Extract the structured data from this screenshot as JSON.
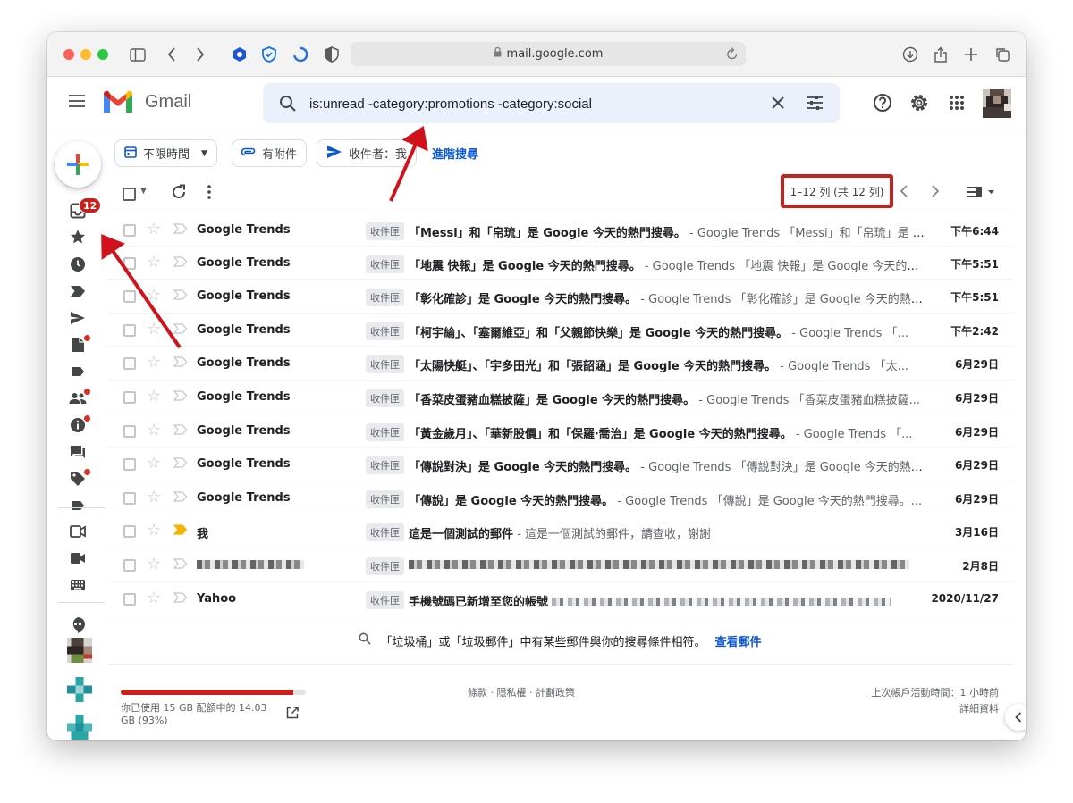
{
  "browser": {
    "url": "mail.google.com"
  },
  "header": {
    "wordmark": "Gmail",
    "search_query": "is:unread -category:promotions -category:social"
  },
  "rail": {
    "inbox_badge": "12"
  },
  "chips": {
    "time": "不限時間",
    "attachment": "有附件",
    "to_me": "收件者：我",
    "advanced_search": "進階搜尋"
  },
  "toolbar": {
    "range": "1–12 列 (共 12 列)"
  },
  "emails": [
    {
      "sender": "Google Trends",
      "label": "收件匣",
      "subject": "「Messi」和「帛琉」是 Google 今天的熱門搜尋。",
      "snippet": " - Google Trends 「Messi」和「帛琉」是 G...",
      "date": "下午6:44",
      "important": false
    },
    {
      "sender": "Google Trends",
      "label": "收件匣",
      "subject": "「地震 快報」是 Google 今天的熱門搜尋。",
      "snippet": " - Google Trends 「地震 快報」是 Google 今天的熱...",
      "date": "下午5:51",
      "important": false
    },
    {
      "sender": "Google Trends",
      "label": "收件匣",
      "subject": "「彰化確診」是 Google 今天的熱門搜尋。",
      "snippet": " - Google Trends 「彰化確診」是 Google 今天的熱門...",
      "date": "下午5:51",
      "important": false
    },
    {
      "sender": "Google Trends",
      "label": "收件匣",
      "subject": "「柯宇綸」、「塞爾維亞」和「父親節快樂」是 Google 今天的熱門搜尋。",
      "snippet": " - Google Trends 「...",
      "date": "下午2:42",
      "important": false
    },
    {
      "sender": "Google Trends",
      "label": "收件匣",
      "subject": "「太陽快艇」、「宇多田光」和「張韶涵」是 Google 今天的熱門搜尋。",
      "snippet": " - Google Trends 「太...",
      "date": "6月29日",
      "important": false
    },
    {
      "sender": "Google Trends",
      "label": "收件匣",
      "subject": "「香菜皮蛋豬血糕披薩」是 Google 今天的熱門搜尋。",
      "snippet": " - Google Trends 「香菜皮蛋豬血糕披薩...",
      "date": "6月29日",
      "important": false
    },
    {
      "sender": "Google Trends",
      "label": "收件匣",
      "subject": "「黃金歲月」、「華新股價」和「保羅‧喬治」是 Google 今天的熱門搜尋。",
      "snippet": " - Google Trends 「...",
      "date": "6月29日",
      "important": false
    },
    {
      "sender": "Google Trends",
      "label": "收件匣",
      "subject": "「傳說對決」是 Google 今天的熱門搜尋。",
      "snippet": " - Google Trends 「傳說對決」是 Google 今天的熱門...",
      "date": "6月29日",
      "important": false
    },
    {
      "sender": "Google Trends",
      "label": "收件匣",
      "subject": "「傳說」是 Google 今天的熱門搜尋。",
      "snippet": " - Google Trends 「傳說」是 Google 今天的熱門搜尋。...",
      "date": "6月29日",
      "important": false
    },
    {
      "sender": "我",
      "label": "收件匣",
      "subject": "這是一個測試的郵件",
      "snippet": " - 這是一個測試的郵件，請查收，謝謝",
      "date": "3月16日",
      "important": true
    },
    {
      "sender": "",
      "label": "收件匣",
      "subject": "",
      "snippet": "",
      "date": "2月8日",
      "important": false,
      "redacted": true
    },
    {
      "sender": "Yahoo",
      "label": "收件匣",
      "subject": "手機號碼已新增至您的帳號",
      "snippet": "",
      "date": "2020/11/27",
      "important": false,
      "redacted_snippet": true
    }
  ],
  "trash_note": {
    "text": "「垃圾桶」或「垃圾郵件」中有某些郵件與你的搜尋條件相符。",
    "link": "查看郵件"
  },
  "footer": {
    "storage_percent": 93,
    "storage_text": "你已使用 15 GB 配額中的 14.03 GB (93%)",
    "links": "條款 · 隱私權 · 計劃政策",
    "last_activity": "上次帳戶活動時間：1 小時前",
    "details": "詳細資料"
  },
  "colors": {
    "accent_red": "#c5221f",
    "link_blue": "#0b57d0",
    "search_bg": "#eaf1fb"
  }
}
